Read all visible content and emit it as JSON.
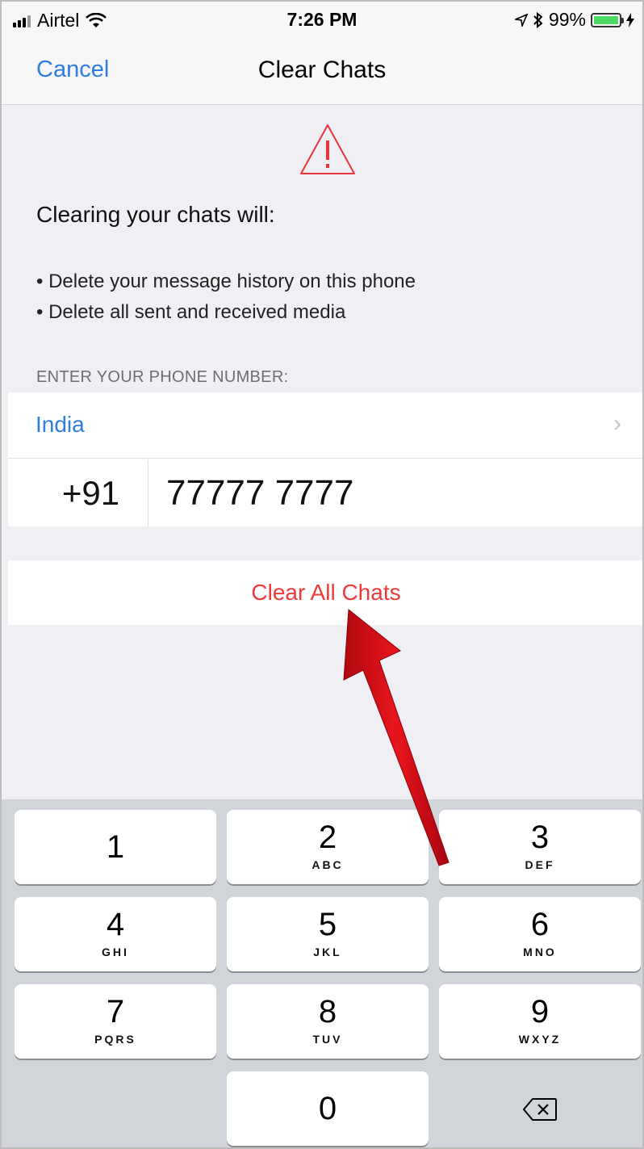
{
  "status_bar": {
    "carrier": "Airtel",
    "time": "7:26 PM",
    "battery": "99%",
    "battery_level": 0.99
  },
  "nav": {
    "cancel_label": "Cancel",
    "title": "Clear Chats"
  },
  "warning": {
    "icon": "warning-triangle-icon",
    "intro": "Clearing your chats will:",
    "bullets": [
      "• Delete your message history on this phone",
      "• Delete all sent and received media"
    ]
  },
  "form": {
    "section_label": "ENTER YOUR PHONE NUMBER:",
    "country": "India",
    "country_code": "+91",
    "phone_value": "77777 7777"
  },
  "clear_button_label": "Clear All Chats",
  "keypad": {
    "keys": [
      {
        "num": "1",
        "letters": ""
      },
      {
        "num": "2",
        "letters": "ABC"
      },
      {
        "num": "3",
        "letters": "DEF"
      },
      {
        "num": "4",
        "letters": "GHI"
      },
      {
        "num": "5",
        "letters": "JKL"
      },
      {
        "num": "6",
        "letters": "MNO"
      },
      {
        "num": "7",
        "letters": "PQRS"
      },
      {
        "num": "8",
        "letters": "TUV"
      },
      {
        "num": "9",
        "letters": "WXYZ"
      },
      {
        "num": "0",
        "letters": ""
      }
    ],
    "delete_icon": "backspace-icon"
  },
  "colors": {
    "accent_blue": "#2f7de1",
    "destructive_red": "#f03a3a",
    "annotation_arrow": "#e0121b"
  }
}
